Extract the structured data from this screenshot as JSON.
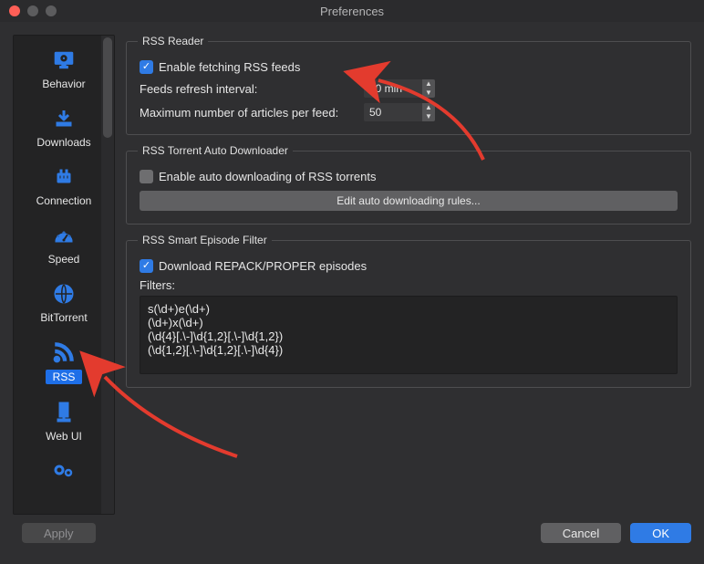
{
  "window": {
    "title": "Preferences"
  },
  "sidebar": {
    "items": [
      {
        "label": "Behavior"
      },
      {
        "label": "Downloads"
      },
      {
        "label": "Connection"
      },
      {
        "label": "Speed"
      },
      {
        "label": "BitTorrent"
      },
      {
        "label": "RSS"
      },
      {
        "label": "Web UI"
      },
      {
        "label": ""
      }
    ],
    "selected_index": 5
  },
  "rss_reader": {
    "legend": "RSS Reader",
    "enable_label": "Enable fetching RSS feeds",
    "enable_checked": true,
    "refresh_label": "Feeds refresh interval:",
    "refresh_value": "30 min",
    "max_label": "Maximum number of articles per feed:",
    "max_value": "50"
  },
  "auto_dl": {
    "legend": "RSS Torrent Auto Downloader",
    "enable_label": "Enable auto downloading of RSS torrents",
    "enable_checked": false,
    "edit_btn": "Edit auto downloading rules..."
  },
  "smart_filter": {
    "legend": "RSS Smart Episode Filter",
    "repack_label": "Download REPACK/PROPER episodes",
    "repack_checked": true,
    "filters_label": "Filters:",
    "filters_text": "s(\\d+)e(\\d+)\n(\\d+)x(\\d+)\n(\\d{4}[.\\-]\\d{1,2}[.\\-]\\d{1,2})\n(\\d{1,2}[.\\-]\\d{1,2}[.\\-]\\d{4})"
  },
  "footer": {
    "apply": "Apply",
    "cancel": "Cancel",
    "ok": "OK"
  }
}
